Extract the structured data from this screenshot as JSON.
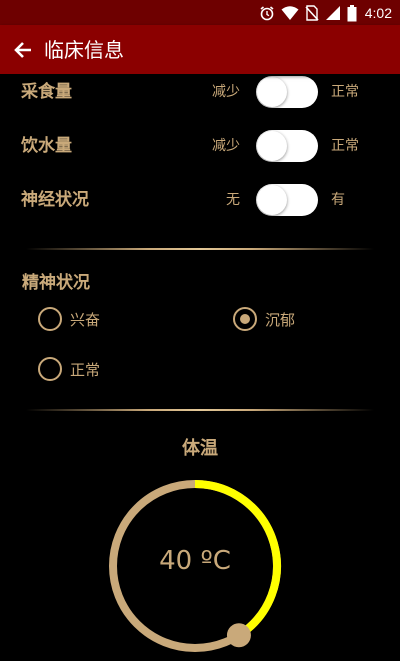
{
  "status_bar": {
    "time": "4:02",
    "icons": [
      "alarm-icon",
      "wifi-icon",
      "no-sim-icon",
      "signal-icon",
      "battery-icon"
    ]
  },
  "app_bar": {
    "title": "临床信息",
    "back_icon": "arrow-left-icon"
  },
  "toggles": [
    {
      "label": "采食量",
      "off_label": "减少",
      "on_label": "正常",
      "on": false
    },
    {
      "label": "饮水量",
      "off_label": "减少",
      "on_label": "正常",
      "on": false
    },
    {
      "label": "神经状况",
      "off_label": "无",
      "on_label": "有",
      "on": false
    }
  ],
  "mental_state": {
    "title": "精神状况",
    "options": [
      {
        "label": "兴奋",
        "checked": false
      },
      {
        "label": "沉郁",
        "checked": true
      },
      {
        "label": "正常",
        "checked": false
      }
    ]
  },
  "temperature": {
    "title": "体温",
    "value_text": "40 ºC",
    "fraction": 0.41
  },
  "colors": {
    "status_bar": "#6e0000",
    "app_bar": "#8b0000",
    "accent_gold": "#c9a97a",
    "gauge_fill": "#ffff00",
    "background": "#000000"
  }
}
